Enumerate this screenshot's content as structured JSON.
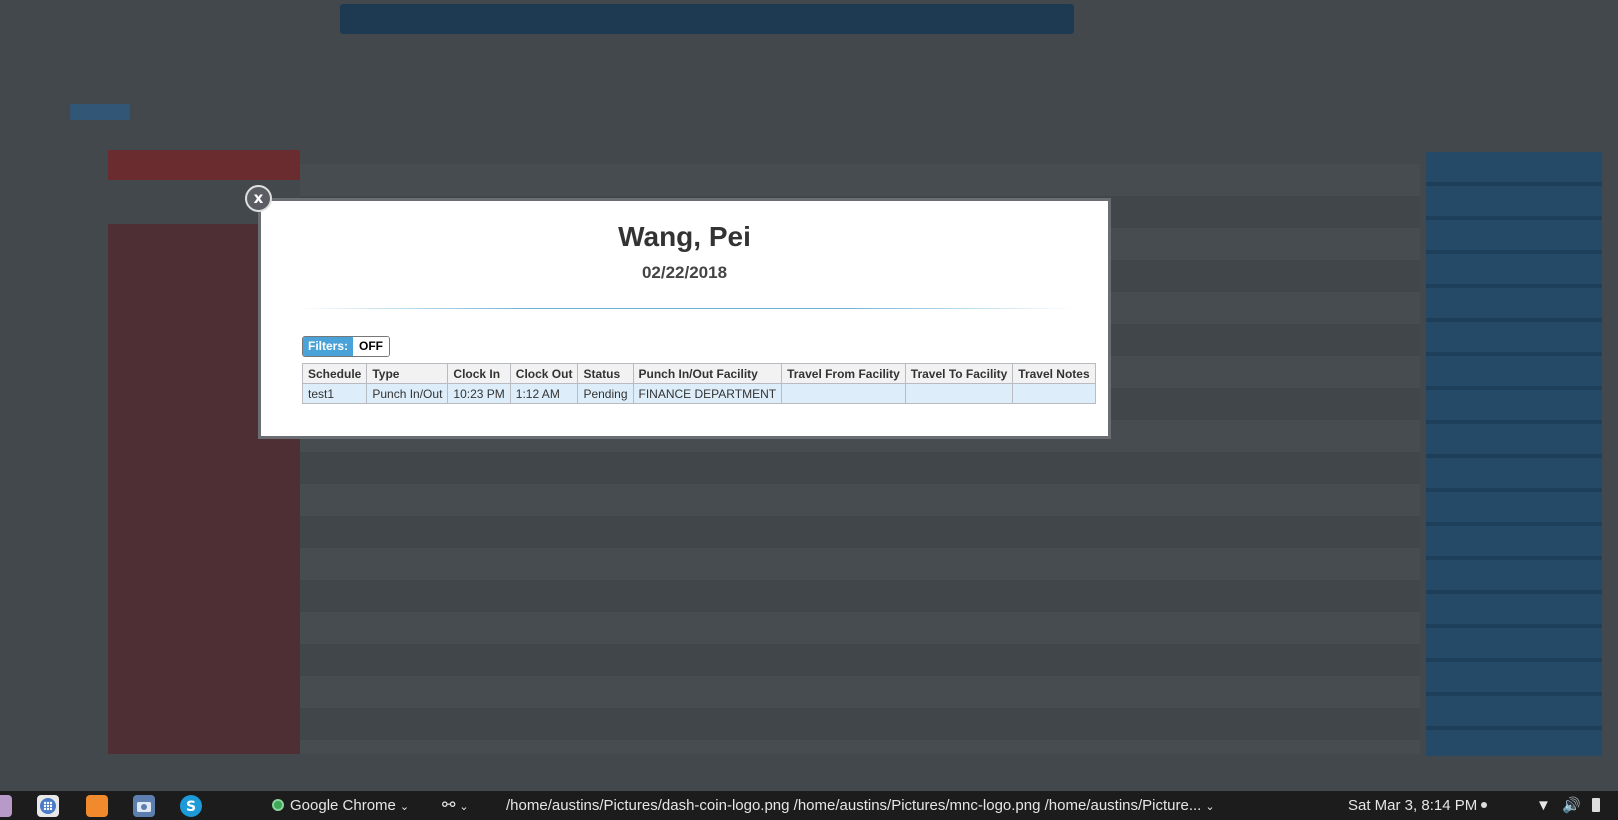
{
  "modal": {
    "close_label": "x",
    "title": "Wang, Pei",
    "date": "02/22/2018",
    "filters_label": "Filters:",
    "filters_state": "OFF",
    "table": {
      "headers": [
        "Schedule",
        "Type",
        "Clock In",
        "Clock Out",
        "Status",
        "Punch In/Out Facility",
        "Travel From Facility",
        "Travel To Facility",
        "Travel Notes"
      ],
      "rows": [
        [
          "test1",
          "Punch In/Out",
          "10:23 PM",
          "1:12 AM",
          "Pending",
          "FINANCE DEPARTMENT",
          "",
          "",
          ""
        ]
      ]
    }
  },
  "taskbar": {
    "apps": [
      "files-icon",
      "app-launcher-icon",
      "firefox-icon",
      "camera-icon",
      "skype-icon"
    ],
    "active_window": "Google Chrome",
    "window_title": "/home/austins/Pictures/dash-coin-logo.png /home/austins/Pictures/mnc-logo.png /home/austins/Picture...",
    "clock": "Sat Mar  3,  8:14 PM"
  }
}
